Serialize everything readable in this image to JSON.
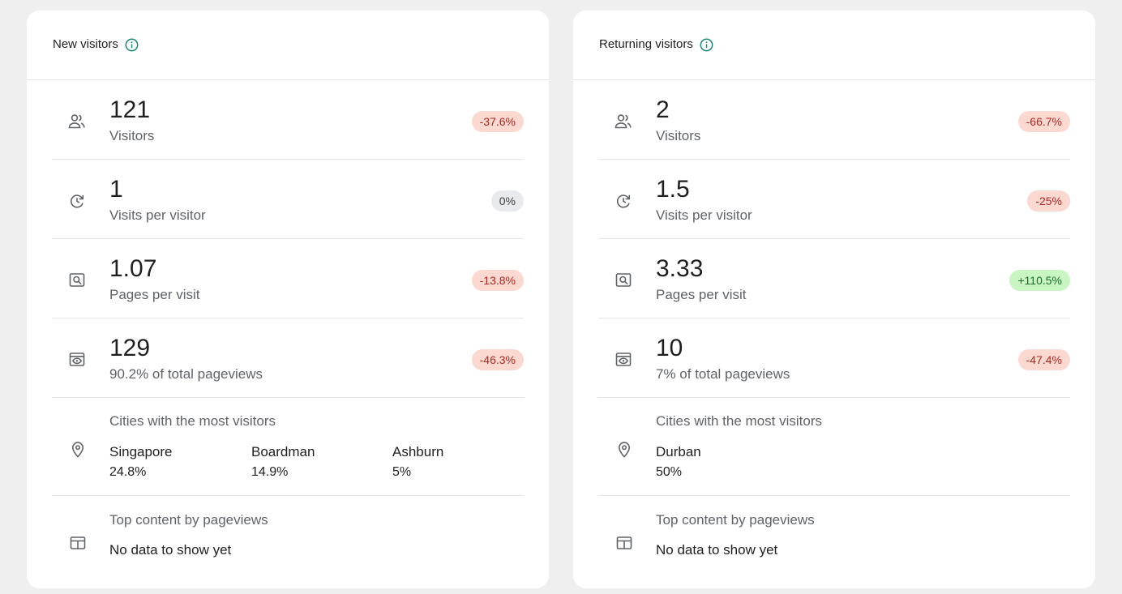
{
  "colors": {
    "info_icon": "#1a8a7a",
    "icon_gray": "#5f6368",
    "badge_negative_bg": "#fbd9d0",
    "badge_negative_text": "#b3261e",
    "badge_neutral_bg": "#e8eaed",
    "badge_positive_bg": "#c9f5c2",
    "badge_positive_text": "#146c2e"
  },
  "new_visitors": {
    "title": "New visitors",
    "metrics": [
      {
        "icon": "people-icon",
        "value": "121",
        "label": "Visitors",
        "change": "-37.6%",
        "trend": "negative"
      },
      {
        "icon": "repeat-clock-icon",
        "value": "1",
        "label": "Visits per visitor",
        "change": "0%",
        "trend": "neutral"
      },
      {
        "icon": "page-search-icon",
        "value": "1.07",
        "label": "Pages per visit",
        "change": "-13.8%",
        "trend": "negative"
      },
      {
        "icon": "pageview-eye-icon",
        "value": "129",
        "label": "90.2% of total pageviews",
        "change": "-46.3%",
        "trend": "negative"
      }
    ],
    "cities": {
      "title": "Cities with the most visitors",
      "items": [
        {
          "name": "Singapore",
          "percent": "24.8%"
        },
        {
          "name": "Boardman",
          "percent": "14.9%"
        },
        {
          "name": "Ashburn",
          "percent": "5%"
        }
      ]
    },
    "top_content": {
      "title": "Top content by pageviews",
      "empty": "No data to show yet"
    }
  },
  "returning_visitors": {
    "title": "Returning visitors",
    "metrics": [
      {
        "icon": "people-icon",
        "value": "2",
        "label": "Visitors",
        "change": "-66.7%",
        "trend": "negative"
      },
      {
        "icon": "repeat-clock-icon",
        "value": "1.5",
        "label": "Visits per visitor",
        "change": "-25%",
        "trend": "negative"
      },
      {
        "icon": "page-search-icon",
        "value": "3.33",
        "label": "Pages per visit",
        "change": "+110.5%",
        "trend": "positive"
      },
      {
        "icon": "pageview-eye-icon",
        "value": "10",
        "label": "7% of total pageviews",
        "change": "-47.4%",
        "trend": "negative"
      }
    ],
    "cities": {
      "title": "Cities with the most visitors",
      "items": [
        {
          "name": "Durban",
          "percent": "50%"
        }
      ]
    },
    "top_content": {
      "title": "Top content by pageviews",
      "empty": "No data to show yet"
    }
  }
}
